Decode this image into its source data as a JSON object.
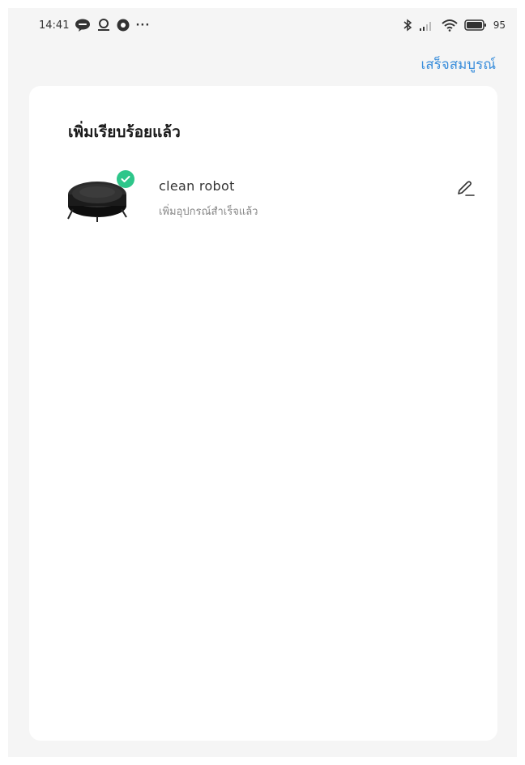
{
  "status_bar": {
    "time": "14:41",
    "more": "···",
    "battery": "95"
  },
  "header": {
    "done_label": "เสร็จสมบูรณ์"
  },
  "card": {
    "title": "เพิ่มเรียบร้อยแล้ว",
    "devices": [
      {
        "name": "clean robot",
        "status": "เพิ่มอุปกรณ์สำเร็จแล้ว",
        "icon": "robot-vacuum-icon"
      }
    ]
  },
  "colors": {
    "accent": "#3a8edb",
    "success": "#2ec68a",
    "background": "#f5f5f5",
    "card": "#ffffff"
  }
}
